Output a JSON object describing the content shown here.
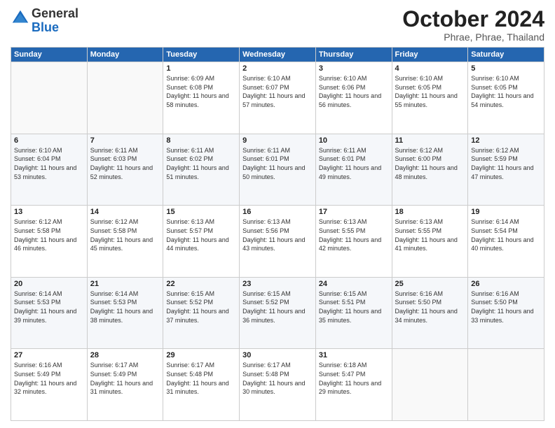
{
  "logo": {
    "general": "General",
    "blue": "Blue"
  },
  "header": {
    "month": "October 2024",
    "location": "Phrae, Phrae, Thailand"
  },
  "weekdays": [
    "Sunday",
    "Monday",
    "Tuesday",
    "Wednesday",
    "Thursday",
    "Friday",
    "Saturday"
  ],
  "weeks": [
    [
      {
        "day": "",
        "empty": true
      },
      {
        "day": "",
        "empty": true
      },
      {
        "day": "1",
        "sunrise": "6:09 AM",
        "sunset": "6:08 PM",
        "daylight": "11 hours and 58 minutes."
      },
      {
        "day": "2",
        "sunrise": "6:10 AM",
        "sunset": "6:07 PM",
        "daylight": "11 hours and 57 minutes."
      },
      {
        "day": "3",
        "sunrise": "6:10 AM",
        "sunset": "6:06 PM",
        "daylight": "11 hours and 56 minutes."
      },
      {
        "day": "4",
        "sunrise": "6:10 AM",
        "sunset": "6:05 PM",
        "daylight": "11 hours and 55 minutes."
      },
      {
        "day": "5",
        "sunrise": "6:10 AM",
        "sunset": "6:05 PM",
        "daylight": "11 hours and 54 minutes."
      }
    ],
    [
      {
        "day": "6",
        "sunrise": "6:10 AM",
        "sunset": "6:04 PM",
        "daylight": "11 hours and 53 minutes."
      },
      {
        "day": "7",
        "sunrise": "6:11 AM",
        "sunset": "6:03 PM",
        "daylight": "11 hours and 52 minutes."
      },
      {
        "day": "8",
        "sunrise": "6:11 AM",
        "sunset": "6:02 PM",
        "daylight": "11 hours and 51 minutes."
      },
      {
        "day": "9",
        "sunrise": "6:11 AM",
        "sunset": "6:01 PM",
        "daylight": "11 hours and 50 minutes."
      },
      {
        "day": "10",
        "sunrise": "6:11 AM",
        "sunset": "6:01 PM",
        "daylight": "11 hours and 49 minutes."
      },
      {
        "day": "11",
        "sunrise": "6:12 AM",
        "sunset": "6:00 PM",
        "daylight": "11 hours and 48 minutes."
      },
      {
        "day": "12",
        "sunrise": "6:12 AM",
        "sunset": "5:59 PM",
        "daylight": "11 hours and 47 minutes."
      }
    ],
    [
      {
        "day": "13",
        "sunrise": "6:12 AM",
        "sunset": "5:58 PM",
        "daylight": "11 hours and 46 minutes."
      },
      {
        "day": "14",
        "sunrise": "6:12 AM",
        "sunset": "5:58 PM",
        "daylight": "11 hours and 45 minutes."
      },
      {
        "day": "15",
        "sunrise": "6:13 AM",
        "sunset": "5:57 PM",
        "daylight": "11 hours and 44 minutes."
      },
      {
        "day": "16",
        "sunrise": "6:13 AM",
        "sunset": "5:56 PM",
        "daylight": "11 hours and 43 minutes."
      },
      {
        "day": "17",
        "sunrise": "6:13 AM",
        "sunset": "5:55 PM",
        "daylight": "11 hours and 42 minutes."
      },
      {
        "day": "18",
        "sunrise": "6:13 AM",
        "sunset": "5:55 PM",
        "daylight": "11 hours and 41 minutes."
      },
      {
        "day": "19",
        "sunrise": "6:14 AM",
        "sunset": "5:54 PM",
        "daylight": "11 hours and 40 minutes."
      }
    ],
    [
      {
        "day": "20",
        "sunrise": "6:14 AM",
        "sunset": "5:53 PM",
        "daylight": "11 hours and 39 minutes."
      },
      {
        "day": "21",
        "sunrise": "6:14 AM",
        "sunset": "5:53 PM",
        "daylight": "11 hours and 38 minutes."
      },
      {
        "day": "22",
        "sunrise": "6:15 AM",
        "sunset": "5:52 PM",
        "daylight": "11 hours and 37 minutes."
      },
      {
        "day": "23",
        "sunrise": "6:15 AM",
        "sunset": "5:52 PM",
        "daylight": "11 hours and 36 minutes."
      },
      {
        "day": "24",
        "sunrise": "6:15 AM",
        "sunset": "5:51 PM",
        "daylight": "11 hours and 35 minutes."
      },
      {
        "day": "25",
        "sunrise": "6:16 AM",
        "sunset": "5:50 PM",
        "daylight": "11 hours and 34 minutes."
      },
      {
        "day": "26",
        "sunrise": "6:16 AM",
        "sunset": "5:50 PM",
        "daylight": "11 hours and 33 minutes."
      }
    ],
    [
      {
        "day": "27",
        "sunrise": "6:16 AM",
        "sunset": "5:49 PM",
        "daylight": "11 hours and 32 minutes."
      },
      {
        "day": "28",
        "sunrise": "6:17 AM",
        "sunset": "5:49 PM",
        "daylight": "11 hours and 31 minutes."
      },
      {
        "day": "29",
        "sunrise": "6:17 AM",
        "sunset": "5:48 PM",
        "daylight": "11 hours and 31 minutes."
      },
      {
        "day": "30",
        "sunrise": "6:17 AM",
        "sunset": "5:48 PM",
        "daylight": "11 hours and 30 minutes."
      },
      {
        "day": "31",
        "sunrise": "6:18 AM",
        "sunset": "5:47 PM",
        "daylight": "11 hours and 29 minutes."
      },
      {
        "day": "",
        "empty": true
      },
      {
        "day": "",
        "empty": true
      }
    ]
  ]
}
